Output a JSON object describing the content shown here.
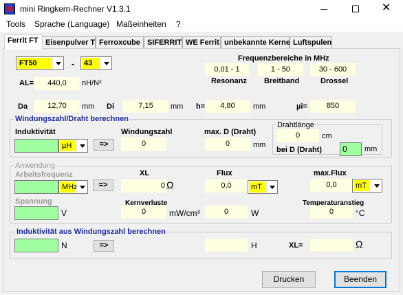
{
  "window": {
    "title": "mini Ringkern-Rechner V1.3.1"
  },
  "menu": [
    "Tools",
    "Sprache (Language)",
    "Maßeinheiten",
    "?"
  ],
  "tabs": [
    "Ferrit FT",
    "Eisenpulver T",
    "Ferroxcube",
    "SIFERRIT",
    "WE Ferrit",
    "unbekannte Kerne",
    "Luftspulen"
  ],
  "core": {
    "type": "FT50",
    "dash": "-",
    "material": "43",
    "al_label": "AL=",
    "al_value": "440,0",
    "al_unit": "nH/N²"
  },
  "freq": {
    "header": "Frequenzbereiche in MHz",
    "resonanz_val": "0,01 - 1",
    "breitband_val": "1 - 50",
    "drossel_val": "30 - 600",
    "resonanz_label": "Resonanz",
    "breitband_label": "Breitband",
    "drossel_label": "Drossel"
  },
  "dims": {
    "da_label": "Da",
    "da_value": "12,70",
    "da_unit": "mm",
    "di_label": "Di",
    "di_value": "7,15",
    "di_unit": "mm",
    "h_label": "h=",
    "h_value": "4,80",
    "h_unit": "mm",
    "mui_label": "µi=",
    "mui_value": "850"
  },
  "g1": {
    "title": "Windungszahl/Draht berechnen",
    "ind_label": "Induktivität",
    "ind_value": "",
    "ind_unit": "µH",
    "arrow": "=>",
    "wz_label": "Windungszahl",
    "wz_value": "0",
    "maxd_label": "max. D (Draht)",
    "maxd_value": "0",
    "maxd_unit": "mm",
    "dl_label": "Drahtlänge",
    "dl_value": "0",
    "dl_unit": "cm",
    "bei_label": "bei D (Draht)",
    "bei_value": "0",
    "bei_unit": "mm"
  },
  "g2": {
    "title": "Anwendung",
    "af_label": "Arbeitsfrequenz",
    "af_value": "",
    "af_unit": "MHz",
    "arrow": "=>",
    "xl_label": "XL",
    "xl_value": "0",
    "xl_unit": "Ω",
    "flux_label": "Flux",
    "flux_value": "0,0",
    "flux_unit": "mT",
    "maxflux_label": "max.Flux",
    "maxflux_value": "0,0",
    "maxflux_unit": "mT",
    "sp_label": "Spannung",
    "sp_value": "",
    "sp_unit": "V",
    "kv_label": "Kernverluste",
    "kv_value": "0",
    "kv_unit": "mW/cm³",
    "w_value": "0",
    "w_unit": "W",
    "ta_label": "Temperaturanstieg",
    "ta_value": "0",
    "ta_unit": "°C"
  },
  "g3": {
    "title": "Induktivität aus Windungszahl berechnen",
    "n_value": "",
    "n_unit": "N",
    "arrow": "=>",
    "h_value": "",
    "h_unit": "H",
    "xl_label": "XL=",
    "xl_value": "",
    "xl_unit": "Ω"
  },
  "buttons": {
    "print": "Drucken",
    "quit": "Beenden"
  },
  "colors": {
    "yellow": "#ffff00",
    "cream": "#ffffe1",
    "green": "#a0ffa0",
    "blue_label": "#1a2aa0",
    "focus": "#0078d7"
  }
}
